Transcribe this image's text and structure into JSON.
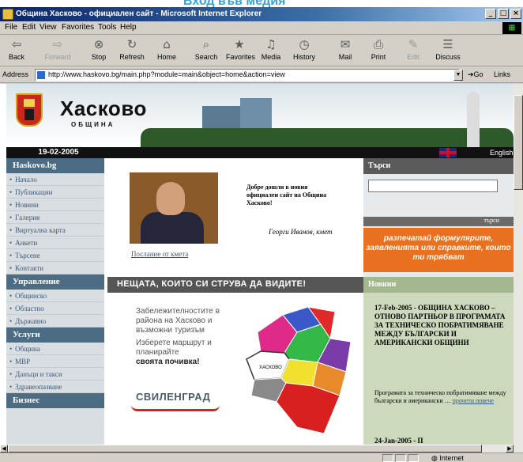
{
  "page_heading": "Вход във медия",
  "window": {
    "title": "Община Хасково - официален сайт - Microsoft Internet Explorer",
    "buttons": [
      "_",
      "□",
      "×"
    ]
  },
  "menu": [
    "File",
    "Edit",
    "View",
    "Favorites",
    "Tools",
    "Help"
  ],
  "toolbar": [
    {
      "label": "Back",
      "icon": "back-arrow-icon",
      "glyph": "⇦",
      "enabled": true
    },
    {
      "label": "Forward",
      "icon": "forward-arrow-icon",
      "glyph": "⇨",
      "enabled": false
    },
    {
      "label": "Stop",
      "icon": "stop-icon",
      "glyph": "⊗",
      "enabled": true
    },
    {
      "label": "Refresh",
      "icon": "refresh-icon",
      "glyph": "↻",
      "enabled": true
    },
    {
      "label": "Home",
      "icon": "home-icon",
      "glyph": "⌂",
      "enabled": true
    },
    {
      "label": "Search",
      "icon": "search-icon",
      "glyph": "⌕",
      "enabled": true
    },
    {
      "label": "Favorites",
      "icon": "favorites-icon",
      "glyph": "★",
      "enabled": true
    },
    {
      "label": "Media",
      "icon": "media-icon",
      "glyph": "♫",
      "enabled": true
    },
    {
      "label": "History",
      "icon": "history-icon",
      "glyph": "◷",
      "enabled": true
    },
    {
      "label": "Mail",
      "icon": "mail-icon",
      "glyph": "✉",
      "enabled": true
    },
    {
      "label": "Print",
      "icon": "print-icon",
      "glyph": "⎙",
      "enabled": true
    },
    {
      "label": "Edit",
      "icon": "edit-icon",
      "glyph": "✎",
      "enabled": false
    },
    {
      "label": "Discuss",
      "icon": "discuss-icon",
      "glyph": "☰",
      "enabled": true
    }
  ],
  "address": {
    "label": "Address",
    "url": "http://www.haskovo.bg/main.php?module=main&object=home&action=view",
    "go": "Go",
    "links": "Links"
  },
  "site": {
    "brand": "Хасково",
    "brand_sub": "ОБЩИНА",
    "date": "19-02-2005",
    "language": "English",
    "nav": [
      {
        "type": "head",
        "label": "Haskovo.bg"
      },
      {
        "type": "item",
        "label": "Начало"
      },
      {
        "type": "item",
        "label": "Публикации"
      },
      {
        "type": "item",
        "label": "Новини"
      },
      {
        "type": "item",
        "label": "Галерия"
      },
      {
        "type": "item",
        "label": "Виртуална карта"
      },
      {
        "type": "item",
        "label": "Анкети"
      },
      {
        "type": "item",
        "label": "Търсене"
      },
      {
        "type": "item",
        "label": "Контакти"
      },
      {
        "type": "head",
        "label": "Управление"
      },
      {
        "type": "item",
        "label": "Общинско"
      },
      {
        "type": "item",
        "label": "Областно"
      },
      {
        "type": "item",
        "label": "Държавно"
      },
      {
        "type": "head",
        "label": "Услуги"
      },
      {
        "type": "item",
        "label": "Община"
      },
      {
        "type": "item",
        "label": "МВР"
      },
      {
        "type": "item",
        "label": "Данъци и такси"
      },
      {
        "type": "item",
        "label": "Здравеопазване"
      },
      {
        "type": "head",
        "label": "Бизнес"
      }
    ],
    "welcome": "Добре дошли в новия официален сайт на Община Хасково!",
    "signature": "Георги Иванов, кмет",
    "mayor_link": "Послание от кмета",
    "see_banner": "НЕЩАТА, КОИТО СИ СТРУВА ДА ВИДИТЕ!",
    "promo": {
      "text1": "Забележителностите в района на Хасково и възможни туризъм",
      "text2": "Изберете маршрут и планирайте",
      "text3": "своята почивка!",
      "town": "СВИЛЕНГРАД",
      "map_label": "ХАСКОВО"
    },
    "search": {
      "heading": "Търси",
      "button": "търси"
    },
    "forms_banner": "разпечатай формулярите, заявленията или справките, които ти трябват",
    "news": {
      "heading": "Новини",
      "title": "17-Feb-2005 - ОБЩИНА ХАСКОВО – ОТНОВО ПАРТНЬОР В ПРОГРАМАТА ЗА ТЕХНИЧЕСКО ПОБРАТИМЯВАНЕ МЕЖДУ БЪЛГАРСКИ И АМЕРИКАНСКИ ОБЩИНИ",
      "text": "Програмата за техническо побратимяване между български и американски …",
      "more": "прочети повече",
      "next": "24-Jan-2005 - П"
    }
  },
  "status": {
    "zone": "Internet"
  }
}
